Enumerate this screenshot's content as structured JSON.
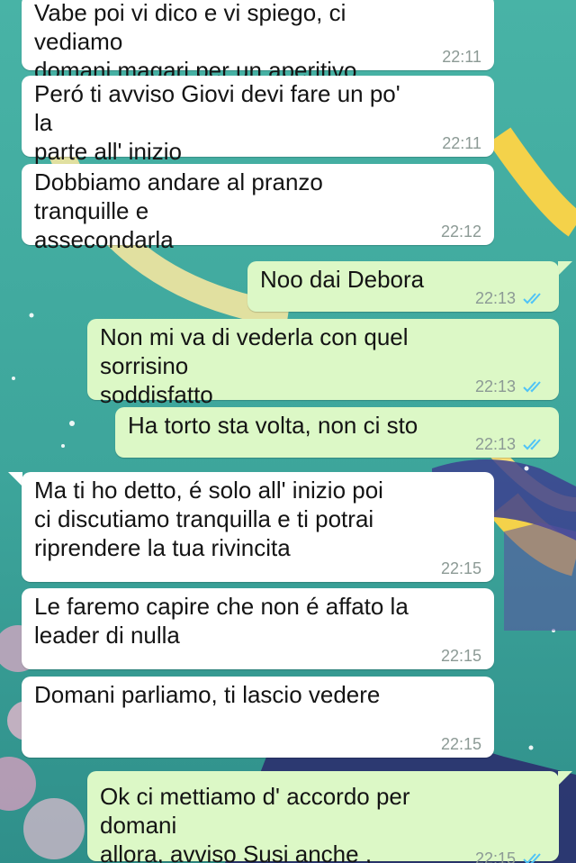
{
  "theme": {
    "wallpaper": "#3fa89e",
    "incoming_bubble": "#ffffff",
    "outgoing_bubble": "#dcf8c6",
    "timestamp": "#8c9a95",
    "read_ticks": "#4fc3f7"
  },
  "messages": [
    {
      "direction": "incoming",
      "text": "Vabe poi vi dico e vi spiego, ci vediamo\ndomani magari per un aperitivo",
      "time": "22:11"
    },
    {
      "direction": "incoming",
      "text": "Peró ti avviso Giovi devi fare un po' la\nparte all' inizio",
      "time": "22:11"
    },
    {
      "direction": "incoming",
      "text": "Dobbiamo andare al pranzo tranquille e\nassecondarla",
      "time": "22:12"
    },
    {
      "direction": "outgoing",
      "text": "Noo dai Debora",
      "time": "22:13",
      "status": "read"
    },
    {
      "direction": "outgoing",
      "text": "Non mi va di vederla con quel sorrisino\nsoddisfatto",
      "time": "22:13",
      "status": "read"
    },
    {
      "direction": "outgoing",
      "text": "Ha torto sta volta, non ci sto",
      "time": "22:13",
      "status": "read"
    },
    {
      "direction": "incoming",
      "text": "Ma ti ho detto, é solo all' inizio poi\nci discutiamo tranquilla e ti potrai\nriprendere la tua rivincita",
      "time": "22:15"
    },
    {
      "direction": "incoming",
      "text": "Le faremo capire che non é affato la\nleader di nulla",
      "time": "22:15"
    },
    {
      "direction": "incoming",
      "text": "Domani parliamo, ti lascio vedere",
      "time": "22:15"
    },
    {
      "direction": "outgoing",
      "text": "Ok ci mettiamo d' accordo per domani\nallora, avviso Susi anche  , buonanotte",
      "time": "22:15",
      "status": "read"
    }
  ]
}
